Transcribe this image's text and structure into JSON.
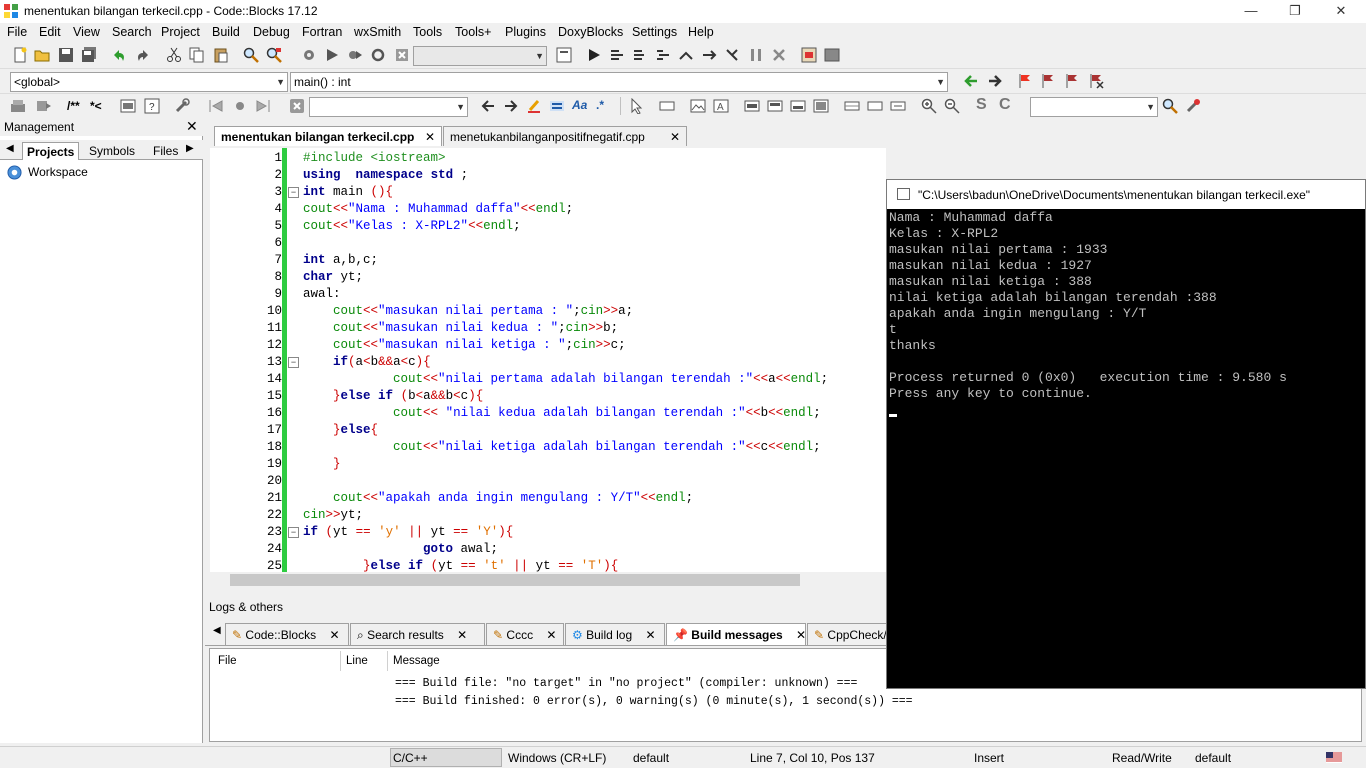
{
  "window": {
    "title": "menentukan bilangan terkecil.cpp - Code::Blocks 17.12",
    "minimize": "—",
    "maximize": "❐",
    "close": "✕"
  },
  "menu": [
    "File",
    "Edit",
    "View",
    "Search",
    "Project",
    "Build",
    "Debug",
    "Fortran",
    "wxSmith",
    "Tools",
    "Tools+",
    "Plugins",
    "DoxyBlocks",
    "Settings",
    "Help"
  ],
  "toolbar": {
    "scope_combo": "<global>",
    "function_combo": "main() : int",
    "doc_comment": "/**",
    "doc_line": "*<"
  },
  "management": {
    "title": "Management",
    "tabs": [
      "Projects",
      "Symbols",
      "Files"
    ],
    "tree_root": "Workspace"
  },
  "editor": {
    "tabs": [
      {
        "label": "menentukan bilangan terkecil.cpp",
        "active": true
      },
      {
        "label": "menetukanbilanganpositifnegatif.cpp",
        "active": false
      }
    ],
    "line_numbers": [
      "1",
      "2",
      "3",
      "4",
      "5",
      "6",
      "7",
      "8",
      "9",
      "10",
      "11",
      "12",
      "13",
      "14",
      "15",
      "16",
      "17",
      "18",
      "19",
      "20",
      "21",
      "22",
      "23",
      "24",
      "25"
    ]
  },
  "logs": {
    "title": "Logs & others",
    "tabs": [
      {
        "label": "Code::Blocks",
        "icon": "document-pencil-icon"
      },
      {
        "label": "Search results",
        "icon": "magnifier-icon"
      },
      {
        "label": "Cccc",
        "icon": "document-pencil-icon"
      },
      {
        "label": "Build log",
        "icon": "gear-icon"
      },
      {
        "label": "Build messages",
        "icon": "pin-icon",
        "active": true
      },
      {
        "label": "CppCheck/Vera++",
        "icon": "document-pencil-icon"
      }
    ],
    "columns": [
      "File",
      "Line",
      "Message"
    ],
    "messages": [
      "=== Build file: \"no target\" in \"no project\" (compiler: unknown) ===",
      "=== Build finished: 0 error(s), 0 warning(s) (0 minute(s), 1 second(s)) ==="
    ]
  },
  "statusbar": {
    "language": "C/C++",
    "eol": "Windows (CR+LF)",
    "encoding": "default",
    "position": "Line 7, Col 10, Pos 137",
    "mode": "Insert",
    "access": "Read/Write",
    "profile": "default"
  },
  "console": {
    "title": "\"C:\\Users\\badun\\OneDrive\\Documents\\menentukan bilangan terkecil.exe\"",
    "lines": [
      "Nama : Muhammad daffa",
      "Kelas : X-RPL2",
      "masukan nilai pertama : 1933",
      "masukan nilai kedua : 1927",
      "masukan nilai ketiga : 388",
      "nilai ketiga adalah bilangan terendah :388",
      "apakah anda ingin mengulang : Y/T",
      "t",
      "thanks",
      "",
      "Process returned 0 (0x0)   execution time : 9.580 s",
      "Press any key to continue."
    ]
  }
}
